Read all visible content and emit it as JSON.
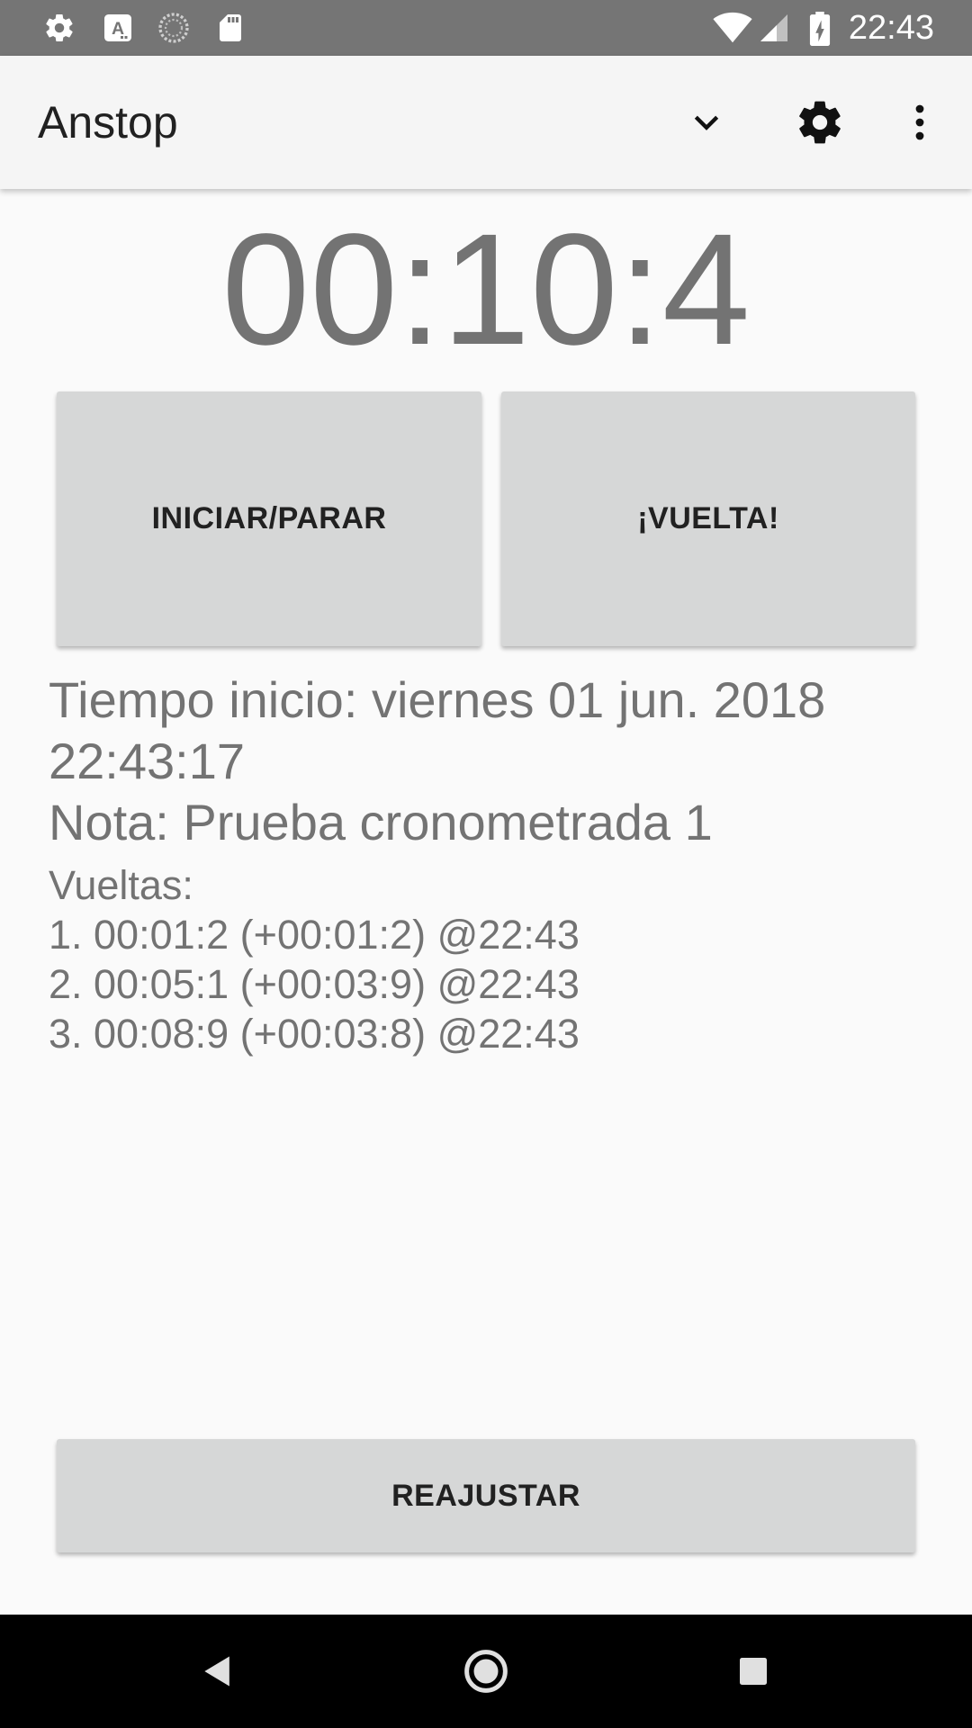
{
  "status_bar": {
    "time": "22:43",
    "left_icons": [
      "settings-icon",
      "text-a-icon",
      "sync-circle-icon",
      "sd-card-icon"
    ],
    "right_icons": [
      "wifi-icon",
      "signal-icon",
      "battery-charging-icon"
    ]
  },
  "app_bar": {
    "title": "Anstop",
    "actions": [
      "chevron-down-icon",
      "gear-icon",
      "more-vert-icon"
    ]
  },
  "timer": {
    "display": "00:10:4"
  },
  "buttons": {
    "start_stop": "INICIAR/PARAR",
    "lap": "¡VUELTA!",
    "reset": "REAJUSTAR"
  },
  "info": {
    "start_time_line1": "Tiempo inicio: viernes 01 jun. 2018",
    "start_time_line2": "22:43:17",
    "note": "Nota: Prueba cronometrada 1",
    "laps_label": "Vueltas:",
    "laps": [
      "1. 00:01:2 (+00:01:2) @22:43",
      "2. 00:05:1 (+00:03:9) @22:43",
      "3. 00:08:9 (+00:03:8) @22:43"
    ]
  },
  "nav_bar": {
    "buttons": [
      "back-icon",
      "home-icon",
      "recents-icon"
    ]
  },
  "colors": {
    "status_bar": "#757575",
    "app_bar": "#f5f5f5",
    "background": "#fafafa",
    "button": "#d6d7d7",
    "text_gray": "#737373",
    "nav_bar": "#000000"
  }
}
